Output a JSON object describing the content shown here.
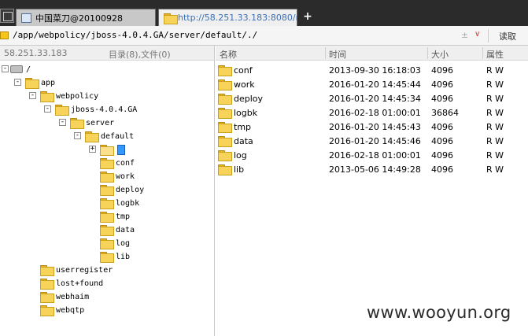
{
  "tabs": [
    {
      "label": "中国菜刀@20100928"
    },
    {
      "label": "http://58.251.33.183:8080/m..."
    }
  ],
  "address": {
    "path": "/app/webpolicy/jboss-4.0.4.GA/server/default/./",
    "dropdown_marks": [
      "±",
      "∨"
    ],
    "read_button": "读取"
  },
  "left_header": {
    "ip": "58.251.33.183",
    "count": "目录(8),文件(0)"
  },
  "tree": [
    {
      "label": "/",
      "icon": "drive-icon",
      "expander": "-"
    },
    {
      "label": "app",
      "icon": "folder-icon",
      "expander": "-"
    },
    {
      "label": "webpolicy",
      "icon": "folder-icon",
      "expander": "-"
    },
    {
      "label": "jboss-4.0.4.GA",
      "icon": "folder-icon",
      "expander": "-"
    },
    {
      "label": "server",
      "icon": "folder-icon",
      "expander": "-"
    },
    {
      "label": "default",
      "icon": "folder-icon",
      "expander": "-"
    },
    {
      "label": "",
      "icon": "folder-open-icon",
      "expander": "+"
    },
    {
      "label": "conf",
      "icon": "folder-icon"
    },
    {
      "label": "work",
      "icon": "folder-icon"
    },
    {
      "label": "deploy",
      "icon": "folder-icon"
    },
    {
      "label": "logbk",
      "icon": "folder-icon"
    },
    {
      "label": "tmp",
      "icon": "folder-icon"
    },
    {
      "label": "data",
      "icon": "folder-icon"
    },
    {
      "label": "log",
      "icon": "folder-icon"
    },
    {
      "label": "lib",
      "icon": "folder-icon"
    },
    {
      "label": "userregister",
      "icon": "folder-icon"
    },
    {
      "label": "lost+found",
      "icon": "folder-icon"
    },
    {
      "label": "webhaim",
      "icon": "folder-icon"
    },
    {
      "label": "webqtp",
      "icon": "folder-icon"
    }
  ],
  "columns": {
    "name": "名称",
    "time": "时间",
    "size": "大小",
    "attr": "属性"
  },
  "files": [
    {
      "name": "conf",
      "time": "2013-09-30 16:18:03",
      "size": "4096",
      "attr": "R W"
    },
    {
      "name": "work",
      "time": "2016-01-20 14:45:44",
      "size": "4096",
      "attr": "R W"
    },
    {
      "name": "deploy",
      "time": "2016-01-20 14:45:34",
      "size": "4096",
      "attr": "R W"
    },
    {
      "name": "logbk",
      "time": "2016-02-18 01:00:01",
      "size": "36864",
      "attr": "R W"
    },
    {
      "name": "tmp",
      "time": "2016-01-20 14:45:43",
      "size": "4096",
      "attr": "R W"
    },
    {
      "name": "data",
      "time": "2016-01-20 14:45:46",
      "size": "4096",
      "attr": "R W"
    },
    {
      "name": "log",
      "time": "2016-02-18 01:00:01",
      "size": "4096",
      "attr": "R W"
    },
    {
      "name": "lib",
      "time": "2013-05-06 14:49:28",
      "size": "4096",
      "attr": "R W"
    }
  ],
  "watermark": "www.wooyun.org"
}
